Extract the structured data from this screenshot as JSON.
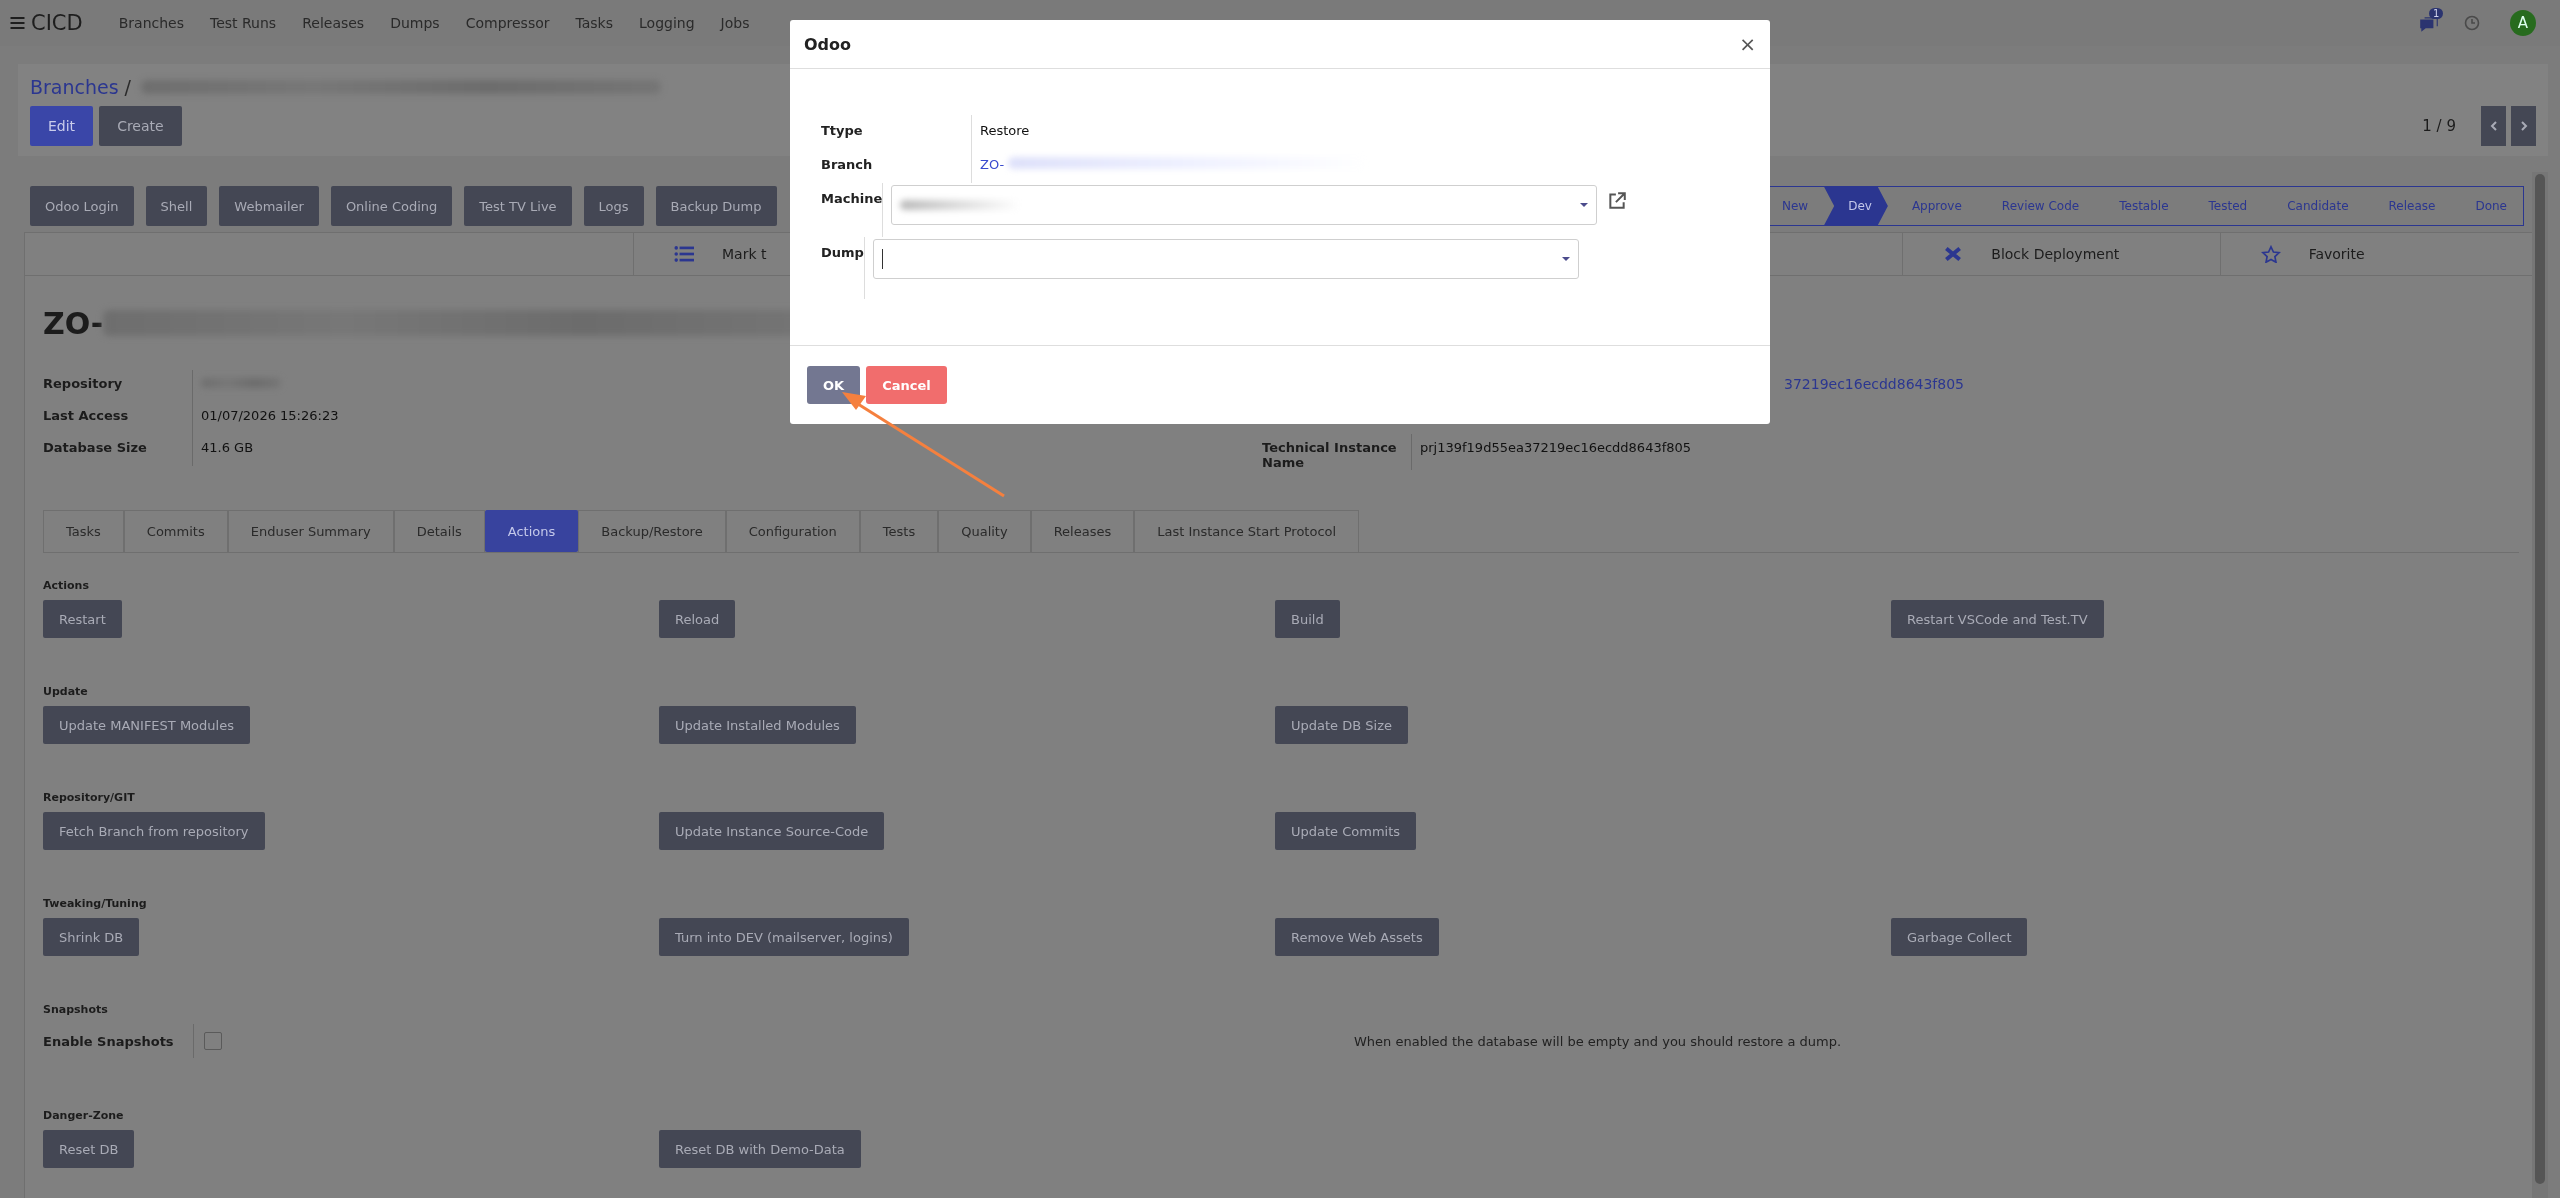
{
  "navbar": {
    "app_title": "CICD",
    "menu": [
      "Branches",
      "Test Runs",
      "Releases",
      "Dumps",
      "Compressor",
      "Tasks",
      "Logging",
      "Jobs"
    ],
    "chat_badge": "1",
    "avatar": "A"
  },
  "breadcrumb": {
    "root": "Branches",
    "separator": "/",
    "current_redacted": true
  },
  "form_buttons": [
    {
      "label": "Edit",
      "primary": true
    },
    {
      "label": "Create",
      "primary": false
    }
  ],
  "pager": {
    "counter": "1 / 9"
  },
  "header_buttons": [
    "Odoo Login",
    "Shell",
    "Webmailer",
    "Online Coding",
    "Test TV Live",
    "Logs",
    "Backup Dump"
  ],
  "stages": [
    {
      "label": "New",
      "selected": false
    },
    {
      "label": "Dev",
      "selected": true
    },
    {
      "label": "Approve",
      "selected": false
    },
    {
      "label": "Review Code",
      "selected": false
    },
    {
      "label": "Testable",
      "selected": false
    },
    {
      "label": "Tested",
      "selected": false
    },
    {
      "label": "Candidate",
      "selected": false
    },
    {
      "label": "Release",
      "selected": false
    },
    {
      "label": "Done",
      "selected": false
    }
  ],
  "smart_buttons": [
    {
      "label": "Mark t"
    },
    {
      "label": "Block Deployment"
    },
    {
      "label": "Favorite"
    }
  ],
  "title": {
    "text": "ZO-",
    "redacted_suffix": true
  },
  "fields_left": [
    {
      "label": "Repository",
      "redacted": true
    },
    {
      "label": "Last Access",
      "value": "01/07/2026 15:26:23",
      "redacted": false
    },
    {
      "label": "Database Size",
      "value": "41.6 GB",
      "redacted": false
    }
  ],
  "fields_right": [
    {
      "value": "37219ec16ecdd8643f805",
      "kind": "link"
    },
    {
      "label": "Technical Instance Name",
      "value": "prj139f19d55ea37219ec16ecdd8643f805",
      "kind": "text"
    }
  ],
  "tabs": [
    {
      "label": "Tasks",
      "selected": false
    },
    {
      "label": "Commits",
      "selected": false
    },
    {
      "label": "Enduser Summary",
      "selected": false
    },
    {
      "label": "Details",
      "selected": false
    },
    {
      "label": "Actions",
      "selected": true
    },
    {
      "label": "Backup/Restore",
      "selected": false
    },
    {
      "label": "Configuration",
      "selected": false
    },
    {
      "label": "Tests",
      "selected": false
    },
    {
      "label": "Quality",
      "selected": false
    },
    {
      "label": "Releases",
      "selected": false
    },
    {
      "label": "Last Instance Start Protocol",
      "selected": false
    }
  ],
  "sections": [
    {
      "title": "Actions",
      "kind": "buttons",
      "buttons": [
        "Restart",
        "Reload",
        "Build",
        "Restart VSCode and Test.TV"
      ]
    },
    {
      "title": "Update",
      "kind": "buttons",
      "buttons": [
        "Update MANIFEST Modules",
        "Update Installed Modules",
        "Update DB Size"
      ]
    },
    {
      "title": "Repository/GIT",
      "kind": "buttons",
      "buttons": [
        "Fetch Branch from repository",
        "Update Instance Source-Code",
        "Update Commits"
      ]
    },
    {
      "title": "Tweaking/Tuning",
      "kind": "buttons",
      "buttons": [
        "Shrink DB",
        "Turn into DEV (mailserver, logins)",
        "Remove Web Assets",
        "Garbage Collect"
      ]
    },
    {
      "title": "Snapshots",
      "kind": "checkbox",
      "label": "Enable Snapshots",
      "checked": false,
      "help": "When enabled the database will be empty and you should restore a dump."
    },
    {
      "title": "Danger-Zone",
      "kind": "buttons",
      "buttons": [
        "Reset DB",
        "Reset DB with Demo-Data"
      ]
    }
  ],
  "modal": {
    "title": "Odoo",
    "close": "×",
    "fields": [
      {
        "label": "Ttype",
        "kind": "text",
        "value": "Restore"
      },
      {
        "label": "Branch",
        "kind": "link",
        "value": "ZO-",
        "redacted_suffix": true
      },
      {
        "label": "Machine",
        "kind": "select",
        "redacted": true,
        "focused": false
      },
      {
        "label": "Dump",
        "kind": "select",
        "redacted": false,
        "focused": true
      }
    ],
    "buttons": [
      {
        "label": "OK",
        "kind": "primary"
      },
      {
        "label": "Cancel",
        "kind": "danger"
      }
    ]
  }
}
